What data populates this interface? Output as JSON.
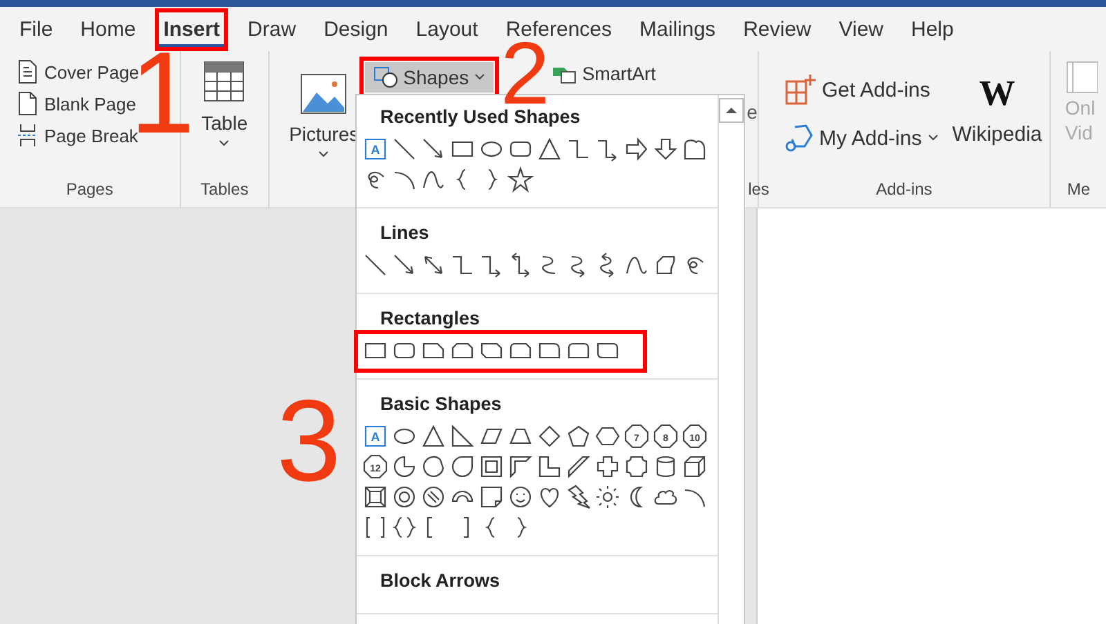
{
  "tabs": [
    {
      "label": "File",
      "selected": false,
      "highlighted": false
    },
    {
      "label": "Home",
      "selected": false,
      "highlighted": false
    },
    {
      "label": "Insert",
      "selected": true,
      "highlighted": true
    },
    {
      "label": "Draw",
      "selected": false,
      "highlighted": false
    },
    {
      "label": "Design",
      "selected": false,
      "highlighted": false
    },
    {
      "label": "Layout",
      "selected": false,
      "highlighted": false
    },
    {
      "label": "References",
      "selected": false,
      "highlighted": false
    },
    {
      "label": "Mailings",
      "selected": false,
      "highlighted": false
    },
    {
      "label": "Review",
      "selected": false,
      "highlighted": false
    },
    {
      "label": "View",
      "selected": false,
      "highlighted": false
    },
    {
      "label": "Help",
      "selected": false,
      "highlighted": false
    }
  ],
  "ribbon": {
    "pages": {
      "items": [
        "Cover Page",
        "Blank Page",
        "Page Break"
      ],
      "label": "Pages"
    },
    "tables": {
      "button": "Table",
      "label": "Tables"
    },
    "illustrations": {
      "pictures": "Pictures",
      "shapes": {
        "label": "Shapes",
        "expanded": true,
        "highlighted": true
      },
      "smartart": "SmartArt",
      "button_fragment": "e",
      "label_fragment": "les"
    },
    "addins": {
      "get": "Get Add-ins",
      "my": "My Add-ins",
      "wikipedia_logo": "W",
      "wikipedia": "Wikipedia",
      "label": "Add-ins"
    },
    "media": {
      "button_lines": [
        "Onl",
        "Vid"
      ],
      "disabled": true,
      "label": "Me"
    }
  },
  "shapes_menu": {
    "sections": [
      {
        "title": "Recently Used Shapes",
        "highlighted": false,
        "shapes": [
          {
            "kind": "textbox",
            "label": "A"
          },
          {
            "kind": "line"
          },
          {
            "kind": "arrow"
          },
          {
            "kind": "rect"
          },
          {
            "kind": "ellipse"
          },
          {
            "kind": "roundrect"
          },
          {
            "kind": "triangle"
          },
          {
            "kind": "elbow"
          },
          {
            "kind": "elbowarrow"
          },
          {
            "kind": "rightarrow"
          },
          {
            "kind": "downarrow"
          },
          {
            "kind": "wavebox"
          },
          {
            "kind": "scribble"
          },
          {
            "kind": "arc"
          },
          {
            "kind": "curve"
          },
          {
            "kind": "lbrace"
          },
          {
            "kind": "rbrace"
          },
          {
            "kind": "star"
          }
        ]
      },
      {
        "title": "Lines",
        "highlighted": false,
        "shapes": [
          {
            "kind": "line"
          },
          {
            "kind": "arrow"
          },
          {
            "kind": "doublearrow"
          },
          {
            "kind": "elbow"
          },
          {
            "kind": "elbowarrow"
          },
          {
            "kind": "elbowdouble"
          },
          {
            "kind": "curvedconn"
          },
          {
            "kind": "curvedarrow"
          },
          {
            "kind": "curveddouble"
          },
          {
            "kind": "curve"
          },
          {
            "kind": "freeform"
          },
          {
            "kind": "scribble"
          }
        ]
      },
      {
        "title": "Rectangles",
        "highlighted": true,
        "shapes": [
          {
            "kind": "rect"
          },
          {
            "kind": "roundrect"
          },
          {
            "kind": "snip1"
          },
          {
            "kind": "snip2same"
          },
          {
            "kind": "snip2diag"
          },
          {
            "kind": "sniproundrect"
          },
          {
            "kind": "round1"
          },
          {
            "kind": "round2same"
          },
          {
            "kind": "round2diag"
          }
        ]
      },
      {
        "title": "Basic Shapes",
        "highlighted": false,
        "shapes": [
          {
            "kind": "textbox",
            "label": "A"
          },
          {
            "kind": "ellipse"
          },
          {
            "kind": "triangle"
          },
          {
            "kind": "righttriangle"
          },
          {
            "kind": "parallelogram"
          },
          {
            "kind": "trapezoid"
          },
          {
            "kind": "diamond"
          },
          {
            "kind": "pentagon"
          },
          {
            "kind": "hexagon"
          },
          {
            "kind": "polygon",
            "label": "7"
          },
          {
            "kind": "polygon",
            "label": "8"
          },
          {
            "kind": "polygon",
            "label": "10"
          },
          {
            "kind": "polygon",
            "label": "12"
          },
          {
            "kind": "pie"
          },
          {
            "kind": "chord"
          },
          {
            "kind": "teardrop"
          },
          {
            "kind": "frame"
          },
          {
            "kind": "halfframe"
          },
          {
            "kind": "lshape"
          },
          {
            "kind": "diagstripe"
          },
          {
            "kind": "cross"
          },
          {
            "kind": "plaque"
          },
          {
            "kind": "can"
          },
          {
            "kind": "cube"
          },
          {
            "kind": "bevel"
          },
          {
            "kind": "donut"
          },
          {
            "kind": "nosymbol"
          },
          {
            "kind": "blockarc"
          },
          {
            "kind": "foldedcorner"
          },
          {
            "kind": "smiley"
          },
          {
            "kind": "heart"
          },
          {
            "kind": "lightning"
          },
          {
            "kind": "sun"
          },
          {
            "kind": "moon"
          },
          {
            "kind": "cloud"
          },
          {
            "kind": "arc"
          },
          {
            "kind": "doublebracket"
          },
          {
            "kind": "doublebrace"
          },
          {
            "kind": "lbracket"
          },
          {
            "kind": "rbracket"
          },
          {
            "kind": "lbrace"
          },
          {
            "kind": "rbrace"
          }
        ]
      },
      {
        "title": "Block Arrows"
      }
    ]
  },
  "annotations": [
    {
      "label": "1"
    },
    {
      "label": "2"
    },
    {
      "label": "3"
    }
  ]
}
